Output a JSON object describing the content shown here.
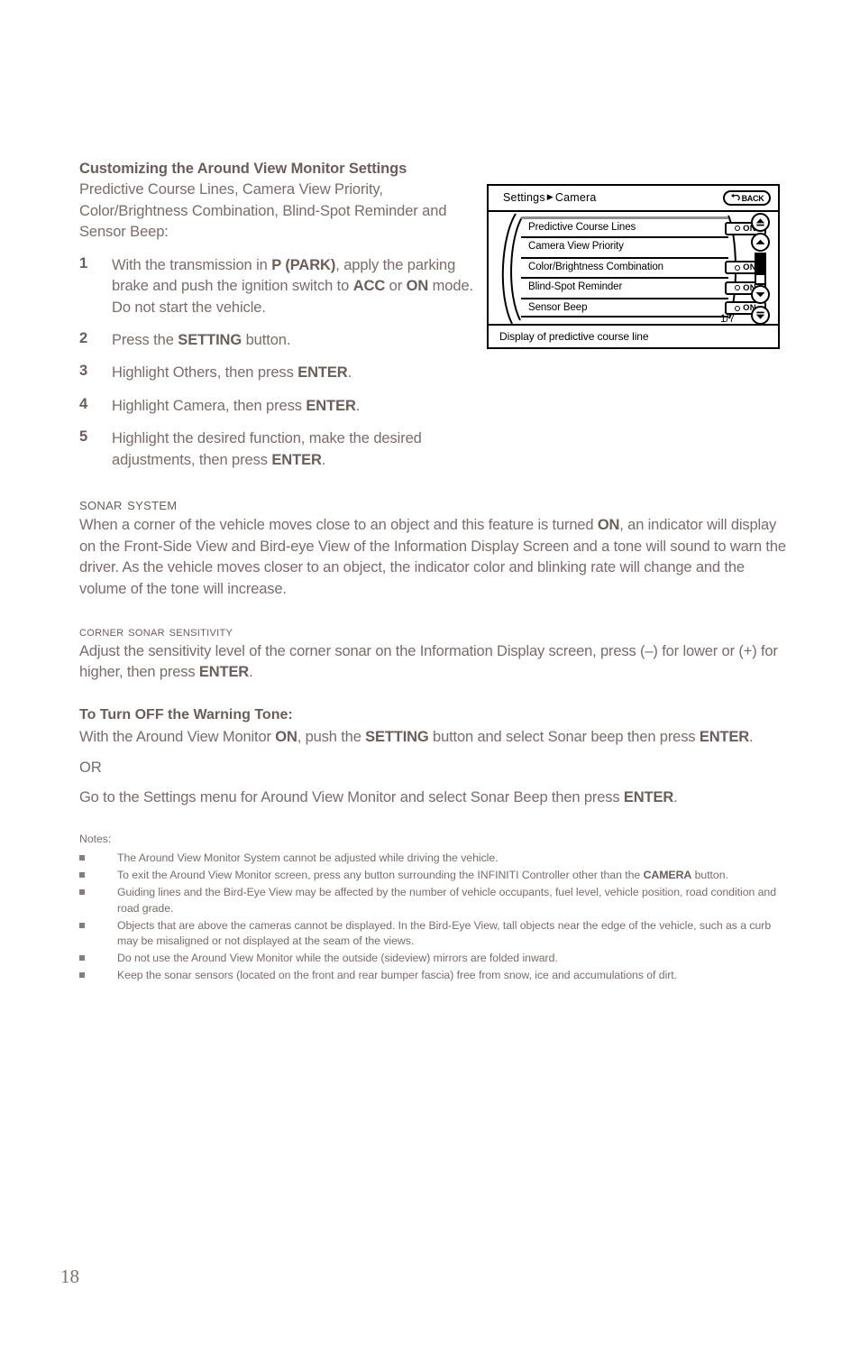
{
  "page": {
    "number": "18"
  },
  "section1": {
    "heading": "Customizing the Around View Monitor Settings",
    "intro": "Predictive Course Lines, Camera View Priority, Color/Brightness Combination, Blind-Spot Reminder and Sensor Beep:",
    "steps": [
      {
        "num": "1",
        "text": "With the transmission in P (PARK), apply the parking brake and push the ignition switch to ACC or ON mode. Do not start the vehicle."
      },
      {
        "num": "2",
        "text": "Press the SETTING button."
      },
      {
        "num": "3",
        "text": "Highlight Others, then press ENTER."
      },
      {
        "num": "4",
        "text": "Highlight Camera, then press ENTER."
      },
      {
        "num": "5",
        "text": "Highlight the desired function, make the desired adjustments, then press ENTER."
      }
    ]
  },
  "sonar_system": {
    "heading": "Sonar System",
    "paragraph": "When a corner of the vehicle moves close to an object and this feature is turned ON, an indicator will display on the Front-Side View and Bird-eye View of the Information Display Screen and a tone will sound to warn the driver. As the vehicle moves closer to an object, the indicator color and blinking rate will change and the volume of the tone will increase."
  },
  "corner_sonar": {
    "heading": "Corner Sonar Sensitivity",
    "paragraph": "Adjust the sensitivity level of the corner sonar on the Information Display screen, press (–) for lower or (+) for higher, then press ENTER."
  },
  "warning_tone": {
    "heading": "To Turn OFF the Warning Tone:",
    "paragraph": "With the Around View Monitor ON, push the SETTING button and select Sonar beep then press ENTER.",
    "or": "OR",
    "alternative": "Go to the Settings menu for Around View Monitor and select Sonar Beep then press ENTER."
  },
  "notes": {
    "title": "Notes:",
    "items": [
      "The Around View Monitor System cannot be adjusted while driving the vehicle.",
      "To exit the Around View Monitor screen, press any button surrounding the INFINITI Controller other than the CAMERA button.",
      "Guiding lines and the Bird-Eye View may be affected by the number of vehicle occupants, fuel level, vehicle position, road condition and road grade.",
      "Objects that are above the cameras cannot be displayed. In the Bird-Eye View, tall objects near the edge of the vehicle, such as a curb may be misaligned or not displayed at the seam of the views.",
      "Do not use the Around View Monitor while the outside (sideview) mirrors are folded inward.",
      "Keep the sonar sensors (located on the front and rear bumper fascia) free from snow, ice and accumulations of dirt."
    ]
  },
  "nav_screen": {
    "breadcrumb_root": "Settings",
    "breadcrumb_sep": "▶",
    "breadcrumb_current": "Camera",
    "back_label": "BACK",
    "menu_items": [
      {
        "label": "Predictive Course Lines",
        "toggle": "ON",
        "has_toggle": true
      },
      {
        "label": "Camera View Priority",
        "toggle": "",
        "has_toggle": false
      },
      {
        "label": "Color/Brightness Combination",
        "toggle": "ON",
        "has_toggle": true
      },
      {
        "label": "Blind-Spot Reminder",
        "toggle": "ON",
        "has_toggle": true
      },
      {
        "label": "Sensor Beep",
        "toggle": "ON",
        "has_toggle": true
      }
    ],
    "page_indicator": "1/7",
    "caption": "Display of predictive course line"
  },
  "colors": {
    "text": "#7a6c69",
    "text_bold": "#6b5d5a",
    "bullet": "#8a7b78",
    "screen_line": "#000000",
    "background": "#ffffff"
  }
}
